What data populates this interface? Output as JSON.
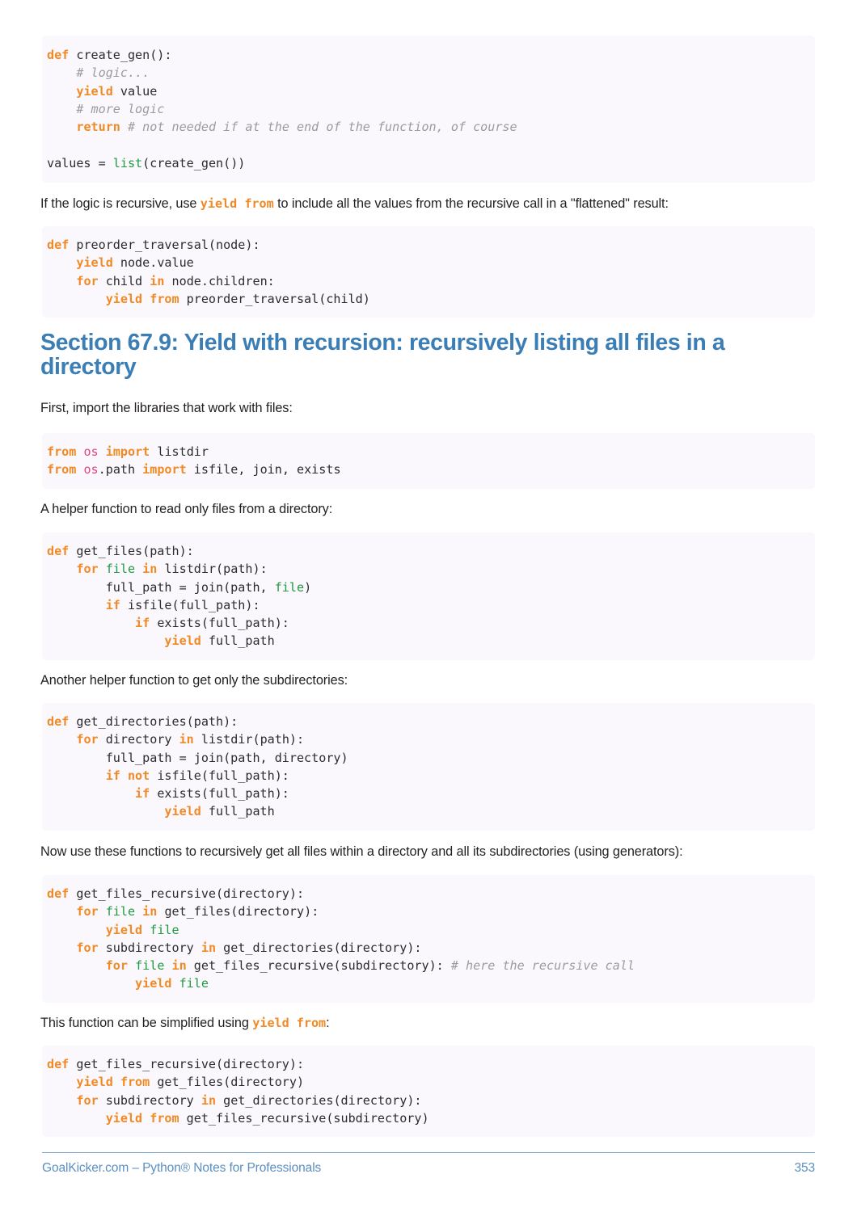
{
  "document": {
    "page_number": "353",
    "footer_text": "GoalKicker.com – Python® Notes for Professionals",
    "accent_blue": "#3b7eb5",
    "footer_blue": "#5b8fc2",
    "code_bg": "#faf8fc",
    "keyword_color": "#f08a26",
    "builtin_color": "#1f9a3f",
    "module_color": "#e0457b",
    "comment_color": "#9b9b9b"
  },
  "blocks": {
    "code1": {
      "lines": [
        [
          {
            "t": "def",
            "c": "kw"
          },
          {
            "t": " create_gen():",
            "c": "pl"
          }
        ],
        [
          {
            "t": "    ",
            "c": "pl"
          },
          {
            "t": "# logic...",
            "c": "cm"
          }
        ],
        [
          {
            "t": "    ",
            "c": "pl"
          },
          {
            "t": "yield",
            "c": "kw"
          },
          {
            "t": " value",
            "c": "pl"
          }
        ],
        [
          {
            "t": "    ",
            "c": "pl"
          },
          {
            "t": "# more logic",
            "c": "cm"
          }
        ],
        [
          {
            "t": "    ",
            "c": "pl"
          },
          {
            "t": "return",
            "c": "kw"
          },
          {
            "t": " ",
            "c": "pl"
          },
          {
            "t": "# not needed if at the end of the function, of course",
            "c": "cm"
          }
        ],
        [
          {
            "t": "",
            "c": "pl"
          }
        ],
        [
          {
            "t": "values = ",
            "c": "pl"
          },
          {
            "t": "list",
            "c": "bi"
          },
          {
            "t": "(create_gen())",
            "c": "pl"
          }
        ]
      ]
    },
    "para1": {
      "segments": [
        {
          "t": "If the logic is recursive, use ",
          "k": "text"
        },
        {
          "t": "yield from",
          "k": "code"
        },
        {
          "t": " to include all the values from the recursive call in a \"flattened\" result:",
          "k": "text"
        }
      ]
    },
    "code2": {
      "lines": [
        [
          {
            "t": "def",
            "c": "kw"
          },
          {
            "t": " preorder_traversal(node):",
            "c": "pl"
          }
        ],
        [
          {
            "t": "    ",
            "c": "pl"
          },
          {
            "t": "yield",
            "c": "kw"
          },
          {
            "t": " node.value",
            "c": "pl"
          }
        ],
        [
          {
            "t": "    ",
            "c": "pl"
          },
          {
            "t": "for",
            "c": "kw"
          },
          {
            "t": " child ",
            "c": "pl"
          },
          {
            "t": "in",
            "c": "kw"
          },
          {
            "t": " node.children:",
            "c": "pl"
          }
        ],
        [
          {
            "t": "        ",
            "c": "pl"
          },
          {
            "t": "yield from",
            "c": "kw"
          },
          {
            "t": " preorder_traversal(child)",
            "c": "pl"
          }
        ]
      ]
    },
    "heading": {
      "text": "Section 67.9: Yield with recursion: recursively listing all files in a directory"
    },
    "para2": {
      "segments": [
        {
          "t": "First, import the libraries that work with files:",
          "k": "text"
        }
      ]
    },
    "code3": {
      "lines": [
        [
          {
            "t": "from",
            "c": "kw"
          },
          {
            "t": " ",
            "c": "pl"
          },
          {
            "t": "os",
            "c": "mod"
          },
          {
            "t": " ",
            "c": "pl"
          },
          {
            "t": "import",
            "c": "kw"
          },
          {
            "t": " listdir",
            "c": "pl"
          }
        ],
        [
          {
            "t": "from",
            "c": "kw"
          },
          {
            "t": " ",
            "c": "pl"
          },
          {
            "t": "os",
            "c": "mod"
          },
          {
            "t": ".path ",
            "c": "pl"
          },
          {
            "t": "import",
            "c": "kw"
          },
          {
            "t": " isfile, join, exists",
            "c": "pl"
          }
        ]
      ]
    },
    "para3": {
      "segments": [
        {
          "t": "A helper function to read only files from a directory:",
          "k": "text"
        }
      ]
    },
    "code4": {
      "lines": [
        [
          {
            "t": "def",
            "c": "kw"
          },
          {
            "t": " get_files(path):",
            "c": "pl"
          }
        ],
        [
          {
            "t": "    ",
            "c": "pl"
          },
          {
            "t": "for",
            "c": "kw"
          },
          {
            "t": " ",
            "c": "pl"
          },
          {
            "t": "file",
            "c": "bi"
          },
          {
            "t": " ",
            "c": "pl"
          },
          {
            "t": "in",
            "c": "kw"
          },
          {
            "t": " listdir(path):",
            "c": "pl"
          }
        ],
        [
          {
            "t": "        full_path = join(path, ",
            "c": "pl"
          },
          {
            "t": "file",
            "c": "bi"
          },
          {
            "t": ")",
            "c": "pl"
          }
        ],
        [
          {
            "t": "        ",
            "c": "pl"
          },
          {
            "t": "if",
            "c": "kw"
          },
          {
            "t": " isfile(full_path):",
            "c": "pl"
          }
        ],
        [
          {
            "t": "            ",
            "c": "pl"
          },
          {
            "t": "if",
            "c": "kw"
          },
          {
            "t": " exists(full_path):",
            "c": "pl"
          }
        ],
        [
          {
            "t": "                ",
            "c": "pl"
          },
          {
            "t": "yield",
            "c": "kw"
          },
          {
            "t": " full_path",
            "c": "pl"
          }
        ]
      ]
    },
    "para4": {
      "segments": [
        {
          "t": "Another helper function to get only the subdirectories:",
          "k": "text"
        }
      ]
    },
    "code5": {
      "lines": [
        [
          {
            "t": "def",
            "c": "kw"
          },
          {
            "t": " get_directories(path):",
            "c": "pl"
          }
        ],
        [
          {
            "t": "    ",
            "c": "pl"
          },
          {
            "t": "for",
            "c": "kw"
          },
          {
            "t": " directory ",
            "c": "pl"
          },
          {
            "t": "in",
            "c": "kw"
          },
          {
            "t": " listdir(path):",
            "c": "pl"
          }
        ],
        [
          {
            "t": "        full_path = join(path, directory)",
            "c": "pl"
          }
        ],
        [
          {
            "t": "        ",
            "c": "pl"
          },
          {
            "t": "if not",
            "c": "kw"
          },
          {
            "t": " isfile(full_path):",
            "c": "pl"
          }
        ],
        [
          {
            "t": "            ",
            "c": "pl"
          },
          {
            "t": "if",
            "c": "kw"
          },
          {
            "t": " exists(full_path):",
            "c": "pl"
          }
        ],
        [
          {
            "t": "                ",
            "c": "pl"
          },
          {
            "t": "yield",
            "c": "kw"
          },
          {
            "t": " full_path",
            "c": "pl"
          }
        ]
      ]
    },
    "para5": {
      "segments": [
        {
          "t": "Now use these functions to recursively get all files within a directory and all its subdirectories (using generators):",
          "k": "text"
        }
      ]
    },
    "code6": {
      "lines": [
        [
          {
            "t": "def",
            "c": "kw"
          },
          {
            "t": " get_files_recursive(directory):",
            "c": "pl"
          }
        ],
        [
          {
            "t": "    ",
            "c": "pl"
          },
          {
            "t": "for",
            "c": "kw"
          },
          {
            "t": " ",
            "c": "pl"
          },
          {
            "t": "file",
            "c": "bi"
          },
          {
            "t": " ",
            "c": "pl"
          },
          {
            "t": "in",
            "c": "kw"
          },
          {
            "t": " get_files(directory):",
            "c": "pl"
          }
        ],
        [
          {
            "t": "        ",
            "c": "pl"
          },
          {
            "t": "yield",
            "c": "kw"
          },
          {
            "t": " ",
            "c": "pl"
          },
          {
            "t": "file",
            "c": "bi"
          }
        ],
        [
          {
            "t": "    ",
            "c": "pl"
          },
          {
            "t": "for",
            "c": "kw"
          },
          {
            "t": " subdirectory ",
            "c": "pl"
          },
          {
            "t": "in",
            "c": "kw"
          },
          {
            "t": " get_directories(directory):",
            "c": "pl"
          }
        ],
        [
          {
            "t": "        ",
            "c": "pl"
          },
          {
            "t": "for",
            "c": "kw"
          },
          {
            "t": " ",
            "c": "pl"
          },
          {
            "t": "file",
            "c": "bi"
          },
          {
            "t": " ",
            "c": "pl"
          },
          {
            "t": "in",
            "c": "kw"
          },
          {
            "t": " get_files_recursive(subdirectory): ",
            "c": "pl"
          },
          {
            "t": "# here the recursive call",
            "c": "cm"
          }
        ],
        [
          {
            "t": "            ",
            "c": "pl"
          },
          {
            "t": "yield",
            "c": "kw"
          },
          {
            "t": " ",
            "c": "pl"
          },
          {
            "t": "file",
            "c": "bi"
          }
        ]
      ]
    },
    "para6": {
      "segments": [
        {
          "t": "This function can be simplified using ",
          "k": "text"
        },
        {
          "t": "yield from",
          "k": "code"
        },
        {
          "t": ":",
          "k": "text"
        }
      ]
    },
    "code7": {
      "lines": [
        [
          {
            "t": "def",
            "c": "kw"
          },
          {
            "t": " get_files_recursive(directory):",
            "c": "pl"
          }
        ],
        [
          {
            "t": "    ",
            "c": "pl"
          },
          {
            "t": "yield from",
            "c": "kw"
          },
          {
            "t": " get_files(directory)",
            "c": "pl"
          }
        ],
        [
          {
            "t": "    ",
            "c": "pl"
          },
          {
            "t": "for",
            "c": "kw"
          },
          {
            "t": " subdirectory ",
            "c": "pl"
          },
          {
            "t": "in",
            "c": "kw"
          },
          {
            "t": " get_directories(directory):",
            "c": "pl"
          }
        ],
        [
          {
            "t": "        ",
            "c": "pl"
          },
          {
            "t": "yield from",
            "c": "kw"
          },
          {
            "t": " get_files_recursive(subdirectory)",
            "c": "pl"
          }
        ]
      ]
    }
  }
}
